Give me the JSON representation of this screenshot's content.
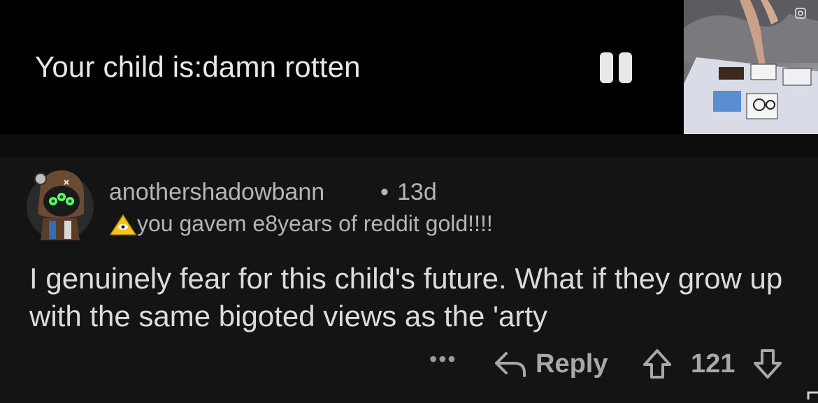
{
  "video": {
    "caption": "Your child is:damn rotten"
  },
  "comment": {
    "username": "anothershadowbann",
    "separator": "•",
    "age": "13d",
    "flair": "you gavem e8years of reddit gold!!!!",
    "body": "I genuinely fear for this child's future. What if they grow up with the same bigoted views as the 'arty"
  },
  "actions": {
    "more": "•••",
    "reply": "Reply",
    "score": "121"
  },
  "icons": {
    "pause": "pause-icon",
    "reply": "reply-arrow-icon",
    "upvote": "upvote-arrow-icon",
    "downvote": "downvote-arrow-icon",
    "flair": "illuminati-pyramid-icon"
  },
  "colors": {
    "background": "#141414",
    "video_background": "#000000",
    "text_primary": "#dcdcdc",
    "text_secondary": "#b5b5b5"
  }
}
